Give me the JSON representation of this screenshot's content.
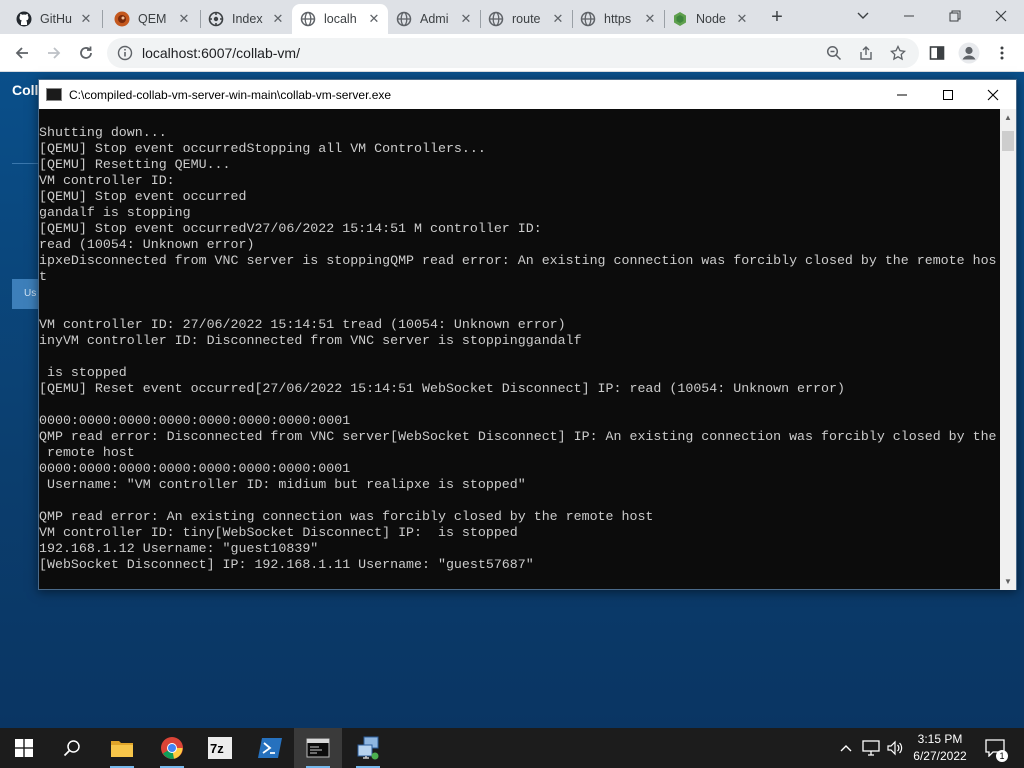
{
  "browser": {
    "tabs": [
      {
        "title": "GitHu",
        "icon": "github-icon"
      },
      {
        "title": "QEM",
        "icon": "qemu-icon"
      },
      {
        "title": "Index",
        "icon": "index-icon"
      },
      {
        "title": "localh",
        "icon": "globe-icon"
      },
      {
        "title": "Admi",
        "icon": "globe-icon"
      },
      {
        "title": "route",
        "icon": "globe-icon"
      },
      {
        "title": "https",
        "icon": "globe-icon"
      },
      {
        "title": "Node",
        "icon": "nodejs-icon"
      }
    ],
    "active_tab_index": 3,
    "url": "localhost:6007/collab-vm/"
  },
  "page": {
    "brand": "Colla",
    "button_fragment": "Us"
  },
  "console": {
    "title": "C:\\compiled-collab-vm-server-win-main\\collab-vm-server.exe",
    "lines": [
      "Shutting down...",
      "[QEMU] Stop event occurredStopping all VM Controllers...",
      "[QEMU] Resetting QEMU...",
      "VM controller ID:",
      "[QEMU] Stop event occurred",
      "gandalf is stopping",
      "[QEMU] Stop event occurredV27/06/2022 15:14:51 M controller ID:",
      "read (10054: Unknown error)",
      "ipxeDisconnected from VNC server is stoppingQMP read error: An existing connection was forcibly closed by the remote hos",
      "t",
      "",
      "",
      "VM controller ID: 27/06/2022 15:14:51 tread (10054: Unknown error)",
      "inyVM controller ID: Disconnected from VNC server is stoppinggandalf",
      "",
      " is stopped",
      "[QEMU] Reset event occurred[27/06/2022 15:14:51 WebSocket Disconnect] IP: read (10054: Unknown error)",
      "",
      "0000:0000:0000:0000:0000:0000:0000:0001",
      "QMP read error: Disconnected from VNC server[WebSocket Disconnect] IP: An existing connection was forcibly closed by the",
      " remote host",
      "0000:0000:0000:0000:0000:0000:0000:0001",
      " Username: \"VM controller ID: midium but realipxe is stopped\"",
      "",
      "QMP read error: An existing connection was forcibly closed by the remote host",
      "VM controller ID: tiny[WebSocket Disconnect] IP:  is stopped",
      "192.168.1.12 Username: \"guest10839\"",
      "[WebSocket Disconnect] IP: 192.168.1.11 Username: \"guest57687\""
    ]
  },
  "taskbar": {
    "apps": [
      "start-icon",
      "search-icon",
      "file-explorer-icon",
      "chrome-icon",
      "7zip-icon",
      "powershell-icon",
      "console-app-icon",
      "network-app-icon"
    ],
    "time": "3:15 PM",
    "date": "6/27/2022",
    "notification_count": "1"
  }
}
